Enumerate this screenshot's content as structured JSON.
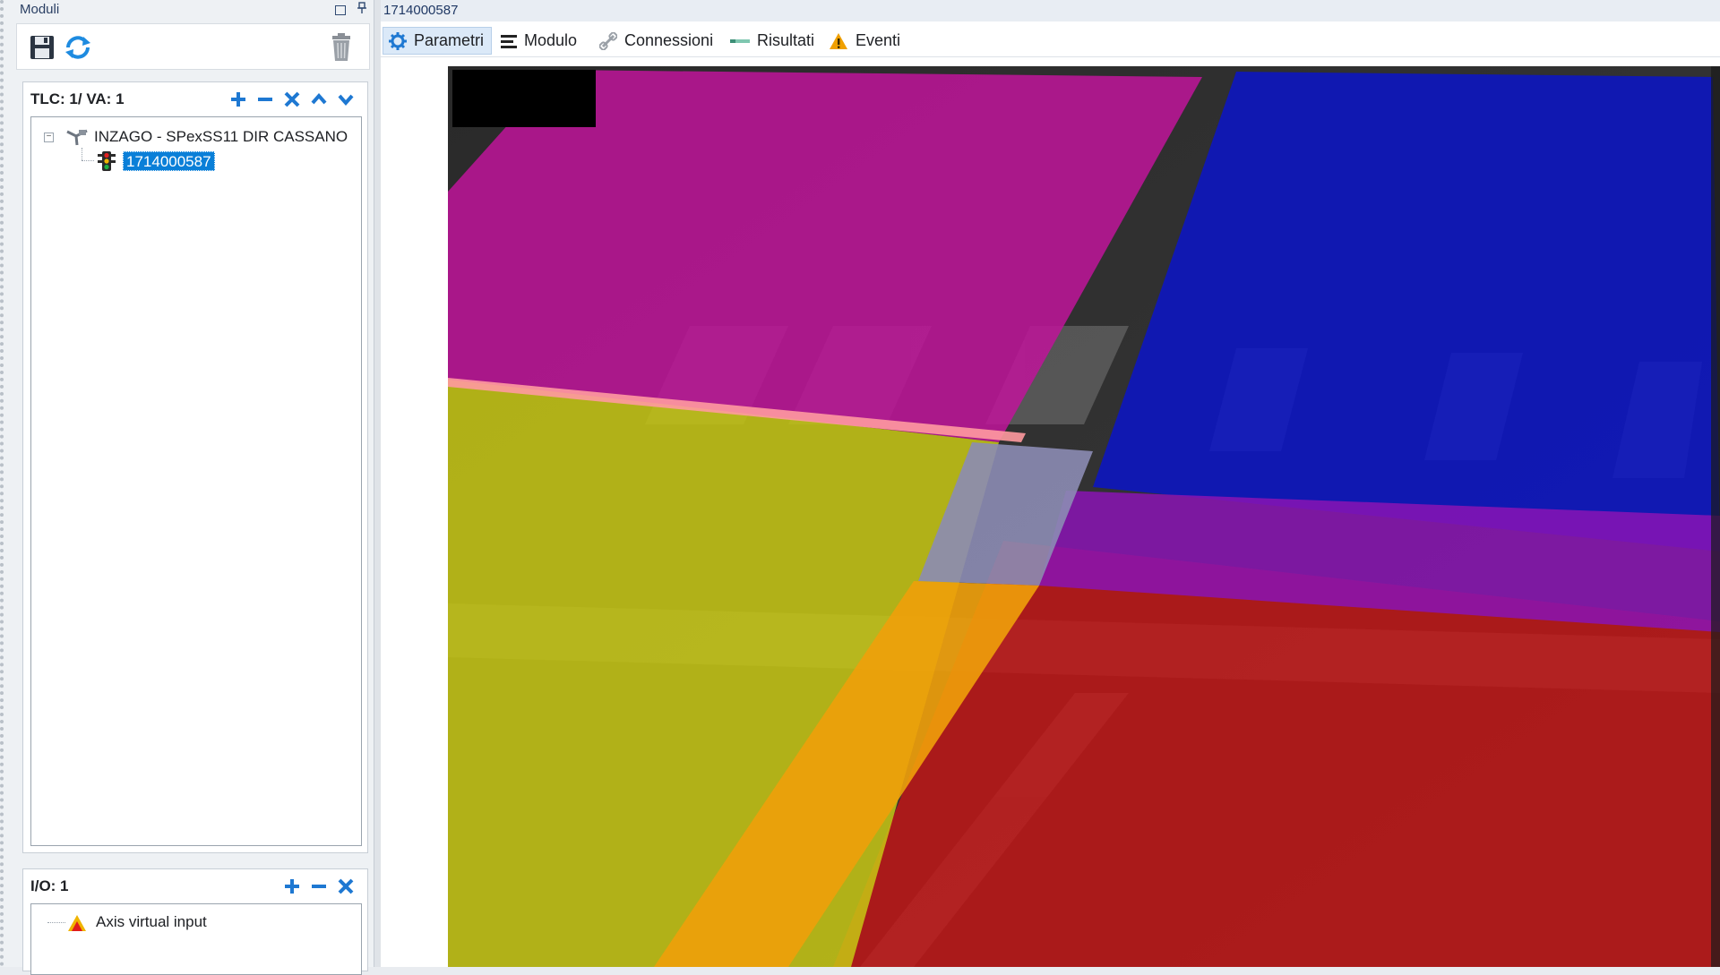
{
  "left_panel": {
    "title": "Moduli",
    "toolbar": {
      "save_icon": "save-icon",
      "refresh_icon": "refresh-icon",
      "delete_icon": "trash-icon"
    },
    "tlc": {
      "header": "TLC: 1/ VA: 1",
      "tree": [
        {
          "label": "INZAGO - SPexSS11 DIR CASSANO",
          "icon": "network-icon",
          "level": 0
        },
        {
          "label": "1714000587",
          "icon": "traffic-light-icon",
          "level": 1,
          "selected": true
        }
      ]
    },
    "io": {
      "header": "I/O: 1",
      "tree": [
        {
          "label": "Axis virtual input",
          "icon": "warning-icon"
        }
      ]
    }
  },
  "right_panel": {
    "title": "1714000587",
    "tabs": [
      {
        "label": "Parametri",
        "icon": "gear-icon",
        "active": true
      },
      {
        "label": "Modulo",
        "icon": "lines-icon"
      },
      {
        "label": "Connessioni",
        "icon": "link-icon"
      },
      {
        "label": "Risultati",
        "icon": "results-icon"
      },
      {
        "label": "Eventi",
        "icon": "warning-icon"
      }
    ]
  },
  "colors": {
    "accent": "#1e78d2",
    "selection": "#0a7fd8",
    "zone_magenta": "#c0149a",
    "zone_blue": "#0a14c8",
    "zone_yellow": "#c8c814",
    "zone_orange": "#f0a00a",
    "zone_red": "#c81414",
    "zone_purple": "#8a14b4"
  }
}
